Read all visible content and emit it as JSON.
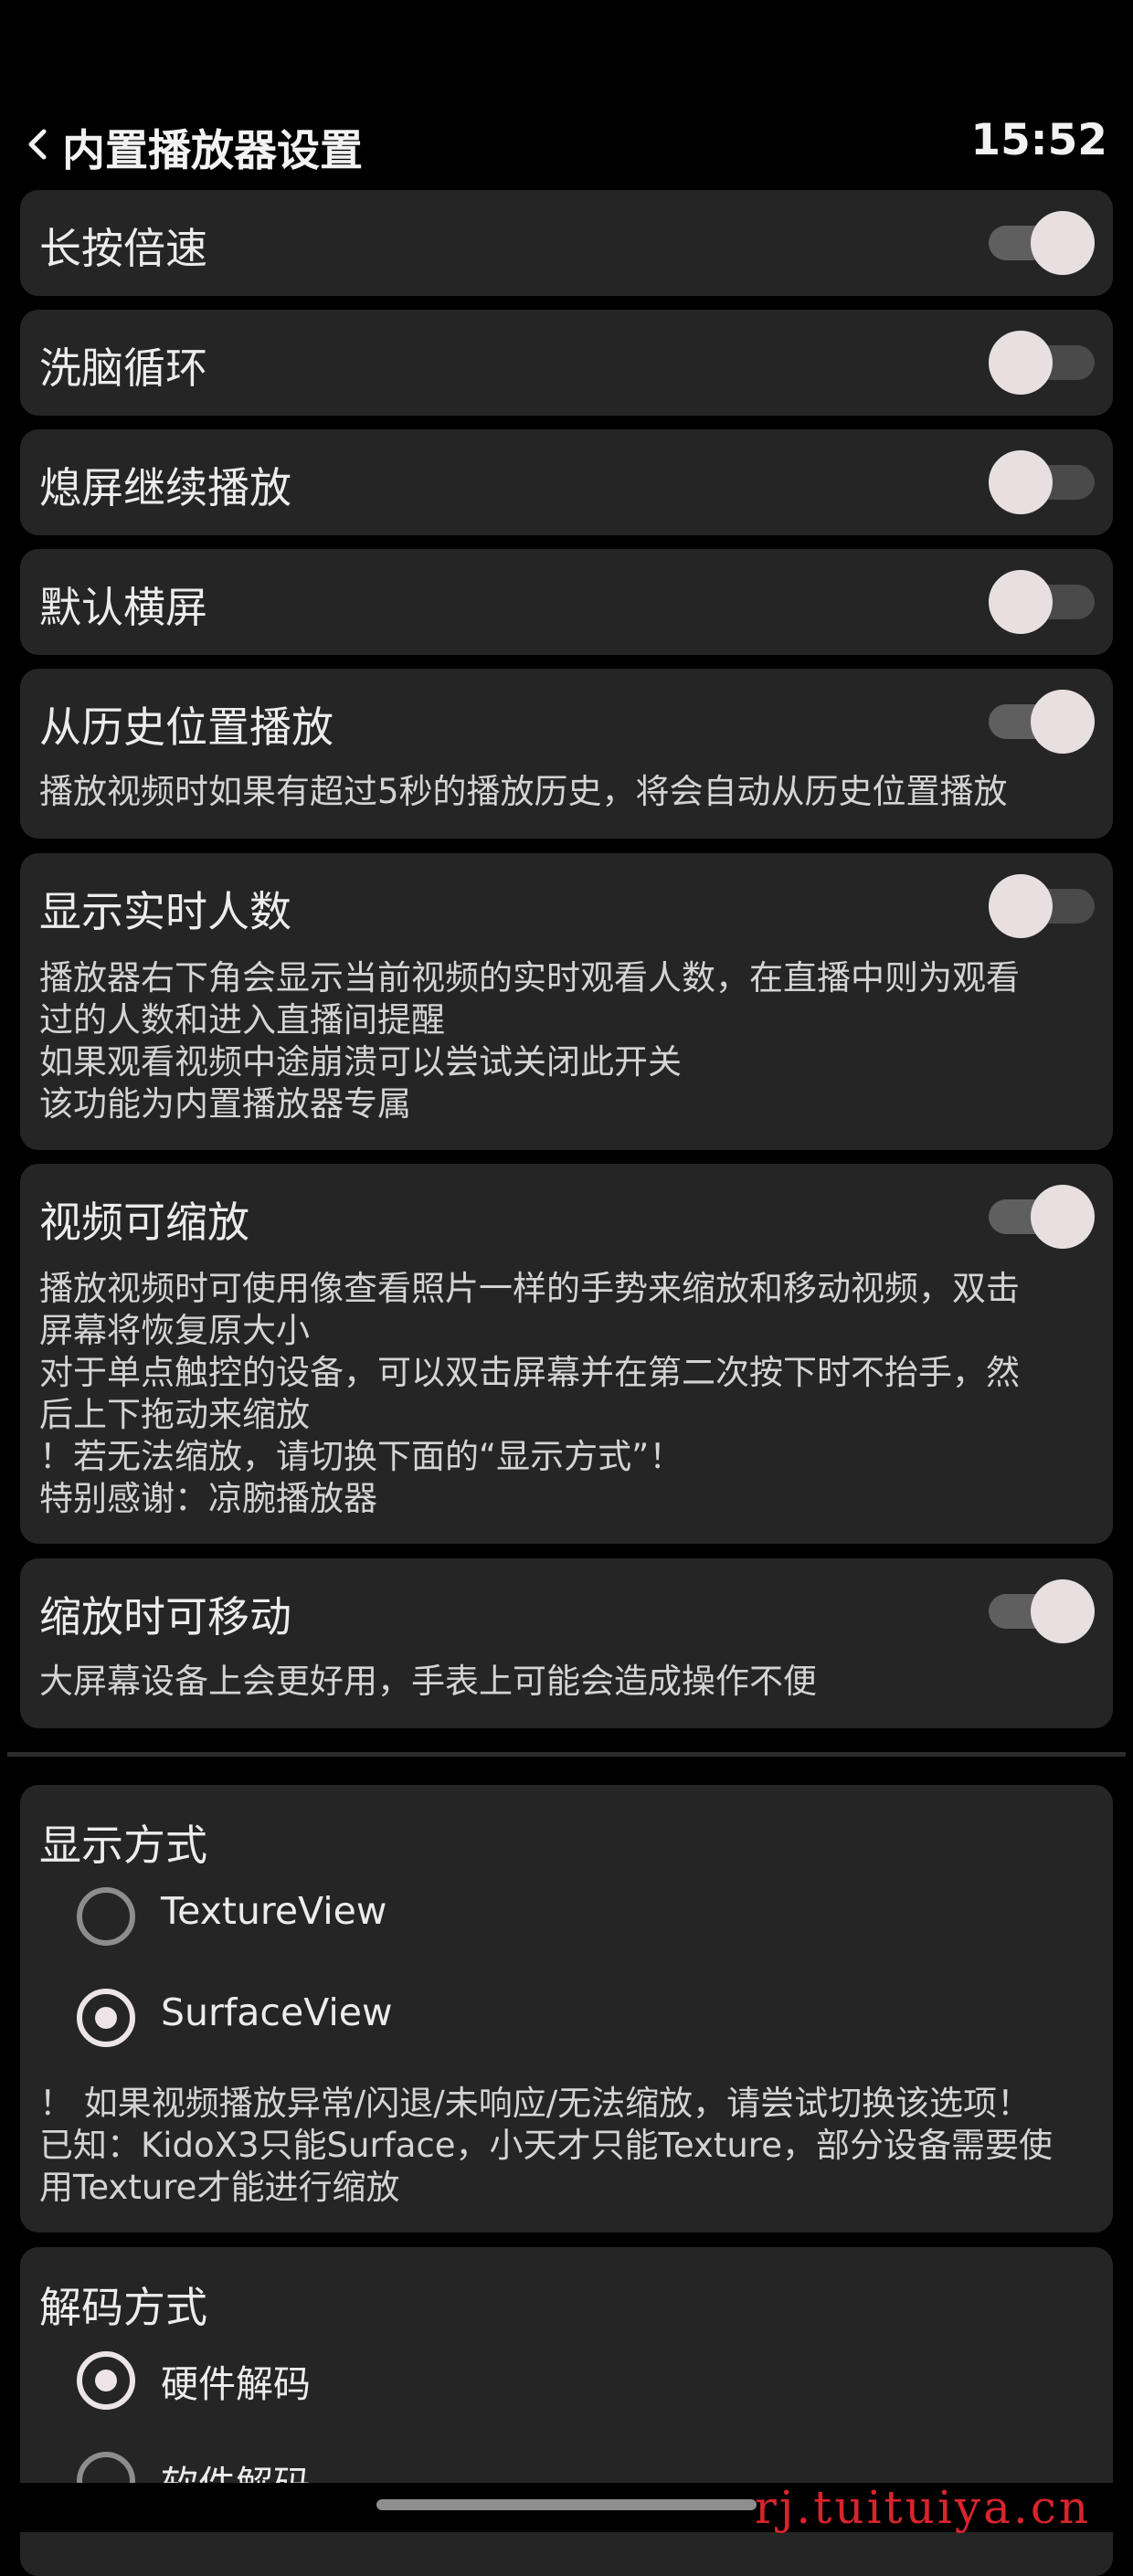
{
  "header": {
    "title": "内置播放器设置",
    "time": "15:52",
    "back_icon": "chevron-left-icon"
  },
  "settings": [
    {
      "title": "长按倍速",
      "enabled": true,
      "desc": []
    },
    {
      "title": "洗脑循环",
      "enabled": false,
      "desc": []
    },
    {
      "title": "熄屏继续播放",
      "enabled": false,
      "desc": []
    },
    {
      "title": "默认横屏",
      "enabled": false,
      "desc": []
    },
    {
      "title": "从历史位置播放",
      "enabled": true,
      "desc": [
        "播放视频时如果有超过5秒的播放历史，将会自动从历史位置播放"
      ]
    },
    {
      "title": "显示实时人数",
      "enabled": false,
      "desc": [
        "播放器右下角会显示当前视频的实时观看人数，在直播中则为观看",
        "过的人数和进入直播间提醒",
        "如果观看视频中途崩溃可以尝试关闭此开关",
        "该功能为内置播放器专属"
      ]
    },
    {
      "title": "视频可缩放",
      "enabled": true,
      "desc": [
        "播放视频时可使用像查看照片一样的手势来缩放和移动视频，双击",
        "屏幕将恢复原大小",
        "对于单点触控的设备，可以双击屏幕并在第二次按下时不抬手，然",
        "后上下拖动来缩放",
        "！若无法缩放，请切换下面的“显示方式”！",
        "特别感谢：凉腕播放器"
      ]
    },
    {
      "title": "缩放时可移动",
      "enabled": true,
      "desc": [
        "大屏幕设备上会更好用，手表上可能会造成操作不便"
      ]
    }
  ],
  "display_mode": {
    "title": "显示方式",
    "options": [
      {
        "label": "TextureView",
        "selected": false
      },
      {
        "label": "SurfaceView",
        "selected": true
      }
    ],
    "note": [
      "！ 如果视频播放异常/闪退/未响应/无法缩放，请尝试切换该选项！",
      "已知：KidoX3只能Surface，小天才只能Texture，部分设备需要使",
      "用Texture才能进行缩放"
    ]
  },
  "decode_mode": {
    "title": "解码方式",
    "options": [
      {
        "label": "硬件解码",
        "selected": true
      },
      {
        "label": "软件解码",
        "selected": false
      }
    ]
  },
  "watermark": "rj.tuituiya.cn"
}
